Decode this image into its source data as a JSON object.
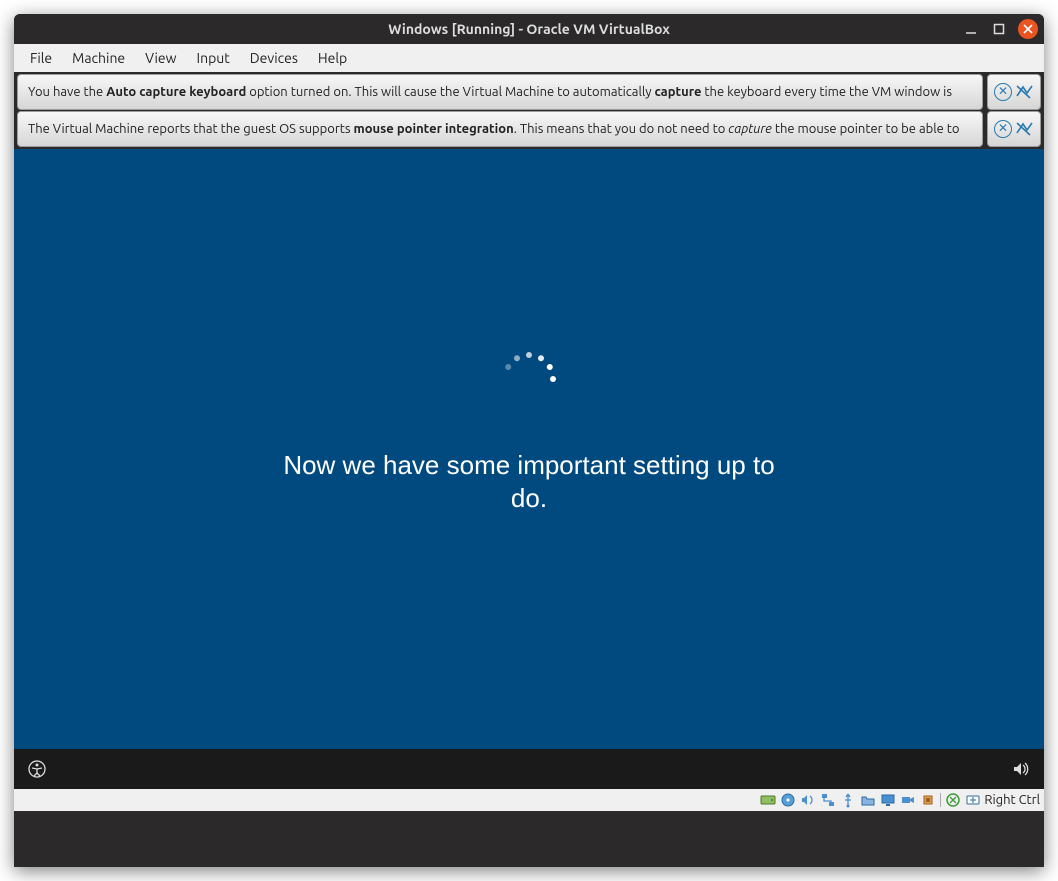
{
  "titlebar": {
    "title": "Windows [Running] - Oracle VM VirtualBox"
  },
  "menu": {
    "items": [
      "File",
      "Machine",
      "View",
      "Input",
      "Devices",
      "Help"
    ]
  },
  "banners": [
    {
      "prefix": "You have the ",
      "bold1": "Auto capture keyboard",
      "mid1": " option turned on. This will cause the Virtual Machine to automatically ",
      "bold2": "capture",
      "suffix": " the keyboard every time the VM window is"
    },
    {
      "prefix": "The Virtual Machine reports that the guest OS supports ",
      "bold1": "mouse pointer integration",
      "mid1": ". This means that you do not need to ",
      "ital1": "capture",
      "suffix": " the mouse pointer to be able to"
    }
  ],
  "guest": {
    "message": "Now we have some important setting up to do."
  },
  "statusbar": {
    "hostkey_label": "Right Ctrl",
    "icons": [
      "hard-disk-icon",
      "optical-disk-icon",
      "audio-icon",
      "network-icon",
      "usb-icon",
      "shared-folders-icon",
      "display-icon",
      "recording-icon",
      "cpu-icon",
      "mouse-icon",
      "keyboard-icon"
    ]
  }
}
